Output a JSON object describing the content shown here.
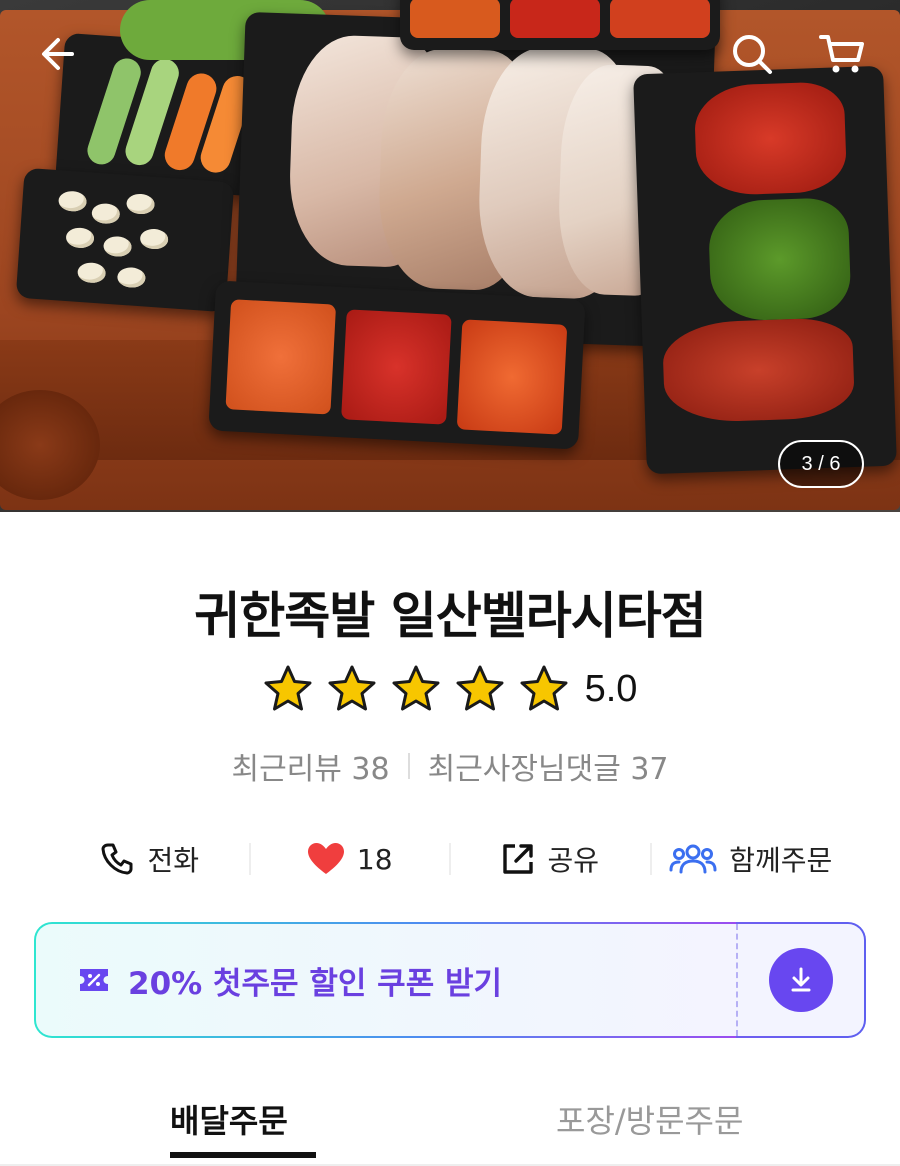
{
  "hero": {
    "pager_text": "3 / 6",
    "icons": {
      "back": "back-arrow-icon",
      "search": "search-icon",
      "cart": "cart-icon"
    }
  },
  "store": {
    "name": "귀한족발 일산벨라시타점",
    "rating": "5.0",
    "star_count": 5,
    "recent_reviews_label": "최근리뷰 38",
    "recent_owner_replies_label": "최근사장님댓글 37"
  },
  "actions": {
    "phone_label": "전화",
    "like_count": "18",
    "share_label": "공유",
    "group_order_label": "함께주문"
  },
  "coupon": {
    "text": "20% 첫주문 할인 쿠폰 받기",
    "icons": {
      "coupon": "coupon-icon",
      "download": "download-icon"
    }
  },
  "tabs": {
    "delivery": "배달주문",
    "pickup": "포장/방문주문",
    "active": "delivery"
  },
  "colors": {
    "accent_purple": "#6847f0",
    "coupon_text": "#6a40e0",
    "heart": "#f03e3e",
    "star": "#f7c600",
    "group_icon": "#3b6ff0"
  }
}
